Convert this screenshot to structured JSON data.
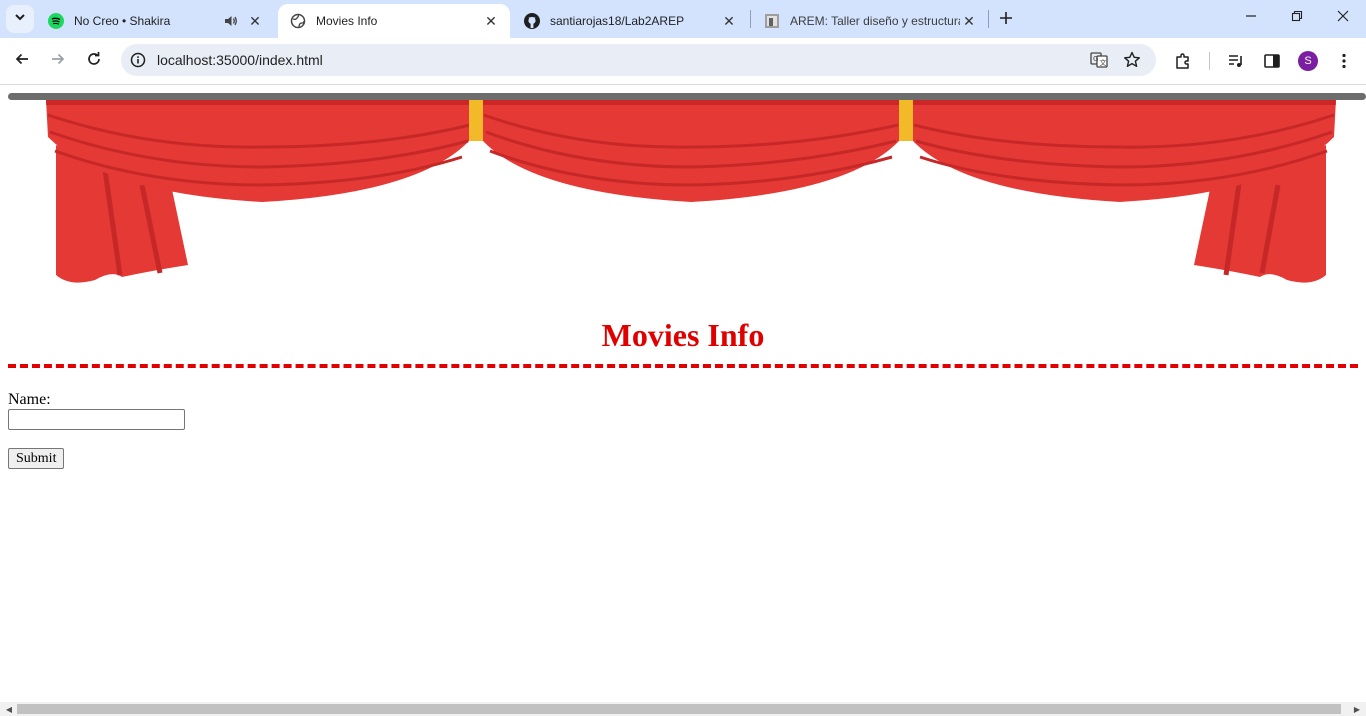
{
  "browser": {
    "tabs": [
      {
        "title": "No Creo • Shakira",
        "favicon": "spotify-icon",
        "audio": true
      },
      {
        "title": "Movies Info",
        "favicon": "globe-icon",
        "active": true
      },
      {
        "title": "santiarojas18/Lab2AREP",
        "favicon": "github-icon"
      },
      {
        "title": "AREM: Taller diseño y estructura",
        "favicon": "document-icon"
      }
    ],
    "url": "localhost:35000/index.html",
    "profile_initial": "S",
    "profile_color": "#7b1fa2"
  },
  "page": {
    "title": "Movies Info",
    "title_color": "#e00000",
    "form": {
      "name_label": "Name:",
      "name_value": "",
      "submit_label": "Submit"
    }
  },
  "colors": {
    "curtain_red": "#e53935",
    "curtain_dark": "#c62828",
    "curtain_gold": "#f2b929",
    "rod_gray": "#6d6d6d"
  }
}
